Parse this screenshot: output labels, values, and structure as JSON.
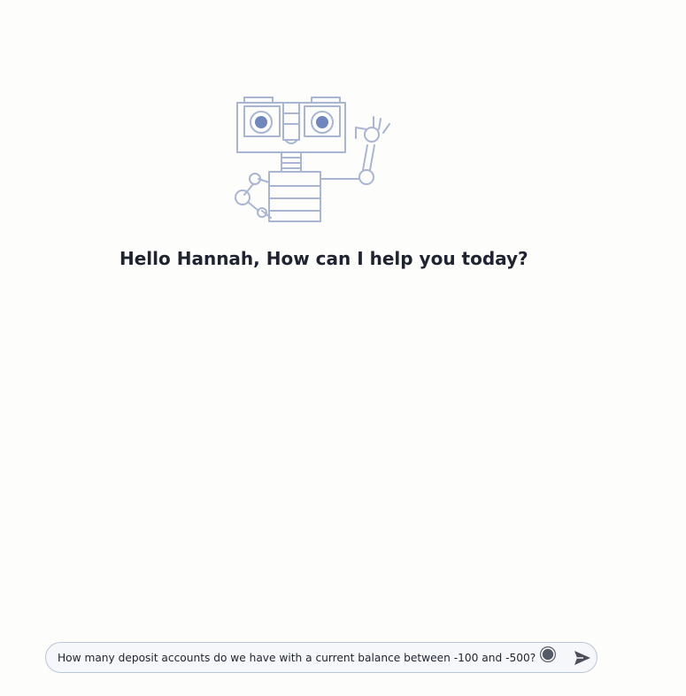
{
  "greeting": {
    "text": "Hello Hannah, How can I help you today?"
  },
  "chat": {
    "input_value": "How many deposit accounts do we have with a current balance between -100 and -500?",
    "placeholder": ""
  },
  "icons": {
    "illustration": "robot-waving-illustration",
    "grammarly": "grammarly-icon",
    "send": "send-icon"
  },
  "colors": {
    "robot_stroke": "#a9b6d3",
    "robot_eye": "#6f87bd",
    "text": "#1f2430",
    "input_border": "#bcc5d6",
    "send_icon": "#4a4f5a"
  }
}
